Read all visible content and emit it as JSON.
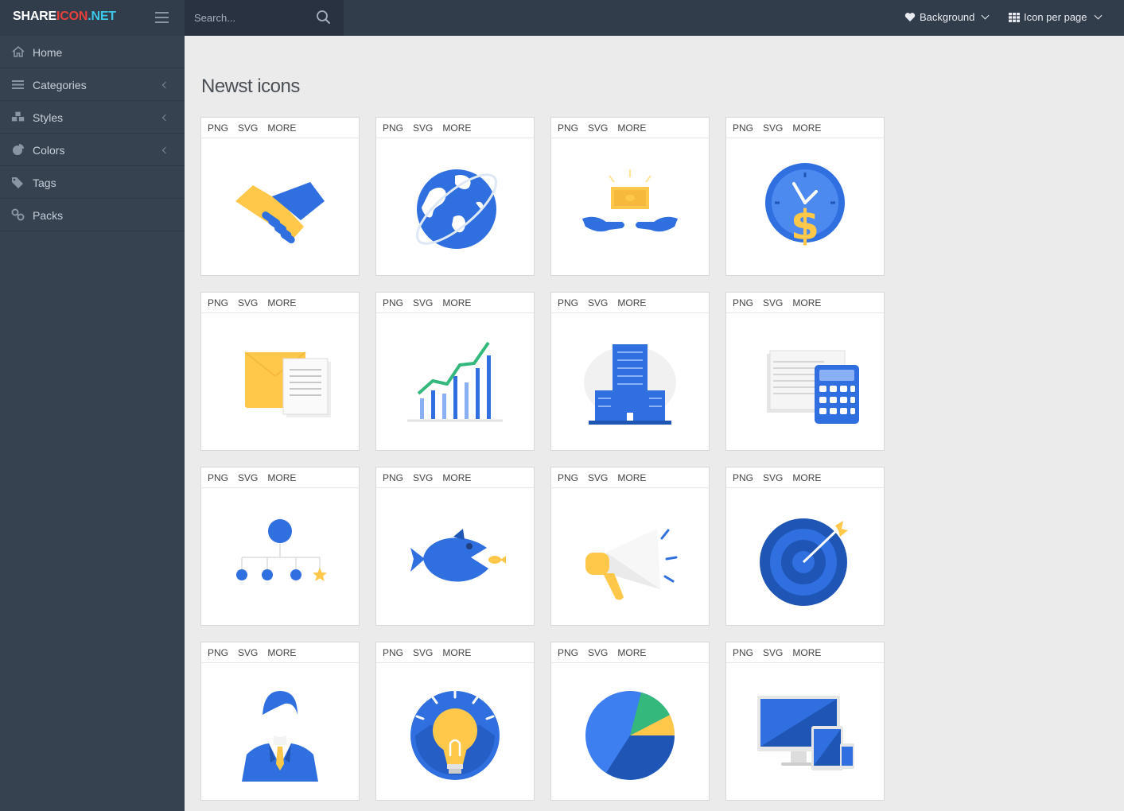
{
  "header": {
    "logo_part1": "SHARE",
    "logo_part2": "ICON",
    "logo_part3": ".NET",
    "search_placeholder": "Search...",
    "background_label": "Background",
    "icon_per_page_label": "Icon per page"
  },
  "sidebar": {
    "items": [
      {
        "label": "Home",
        "icon": "home-icon"
      },
      {
        "label": "Categories",
        "icon": "list-icon"
      },
      {
        "label": "Styles",
        "icon": "cubes-icon"
      },
      {
        "label": "Colors",
        "icon": "pie-icon"
      },
      {
        "label": "Tags",
        "icon": "tags-icon"
      },
      {
        "label": "Packs",
        "icon": "link-icon"
      }
    ]
  },
  "main": {
    "title": "Newst icons",
    "action_png": "PNG",
    "action_svg": "SVG",
    "action_more": "MORE",
    "icons": [
      {
        "name": "handshake-icon"
      },
      {
        "name": "globe-icon"
      },
      {
        "name": "money-hands-icon"
      },
      {
        "name": "clock-dollar-icon"
      },
      {
        "name": "folder-documents-icon"
      },
      {
        "name": "growth-chart-icon"
      },
      {
        "name": "office-building-icon"
      },
      {
        "name": "calculator-papers-icon"
      },
      {
        "name": "hierarchy-icon"
      },
      {
        "name": "big-fish-icon"
      },
      {
        "name": "megaphone-icon"
      },
      {
        "name": "target-icon"
      },
      {
        "name": "businessman-icon"
      },
      {
        "name": "lightbulb-icon"
      },
      {
        "name": "pie-chart-icon"
      },
      {
        "name": "devices-icon"
      }
    ]
  },
  "colors": {
    "blue": "#2f6fdf",
    "yellow": "#ffc84a",
    "sidebar": "#374250",
    "topbar": "#323d4c"
  }
}
